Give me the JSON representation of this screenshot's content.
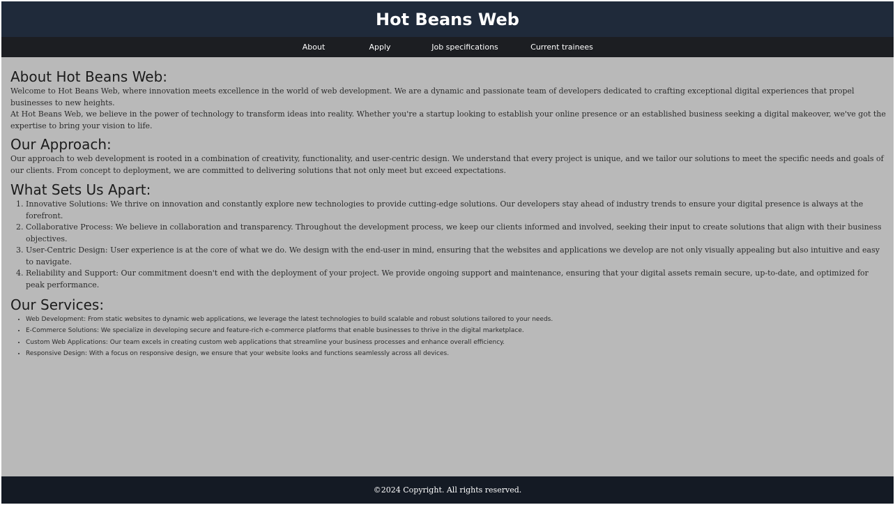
{
  "header": {
    "title": "Hot Beans Web"
  },
  "nav": {
    "items": [
      "About",
      "Apply",
      "Job specifications",
      "Current trainees"
    ]
  },
  "about": {
    "heading": "About Hot Beans Web:",
    "p1": "Welcome to Hot Beans Web, where innovation meets excellence in the world of web development. We are a dynamic and passionate team of developers dedicated to crafting exceptional digital experiences that propel businesses to new heights.",
    "p2": "At Hot Beans Web, we believe in the power of technology to transform ideas into reality. Whether you're a startup looking to establish your online presence or an established business seeking a digital makeover, we've got the expertise to bring your vision to life."
  },
  "approach": {
    "heading": "Our Approach:",
    "p1": "Our approach to web development is rooted in a combination of creativity, functionality, and user-centric design. We understand that every project is unique, and we tailor our solutions to meet the specific needs and goals of our clients. From concept to deployment, we are committed to delivering solutions that not only meet but exceed expectations."
  },
  "apart": {
    "heading": "What Sets Us Apart:",
    "items": [
      "Innovative Solutions: We thrive on innovation and constantly explore new technologies to provide cutting-edge solutions. Our developers stay ahead of industry trends to ensure your digital presence is always at the forefront.",
      "Collaborative Process: We believe in collaboration and transparency. Throughout the development process, we keep our clients informed and involved, seeking their input to create solutions that align with their business objectives.",
      "User-Centric Design: User experience is at the core of what we do. We design with the end-user in mind, ensuring that the websites and applications we develop are not only visually appealing but also intuitive and easy to navigate.",
      "Reliability and Support: Our commitment doesn't end with the deployment of your project. We provide ongoing support and maintenance, ensuring that your digital assets remain secure, up-to-date, and optimized for peak performance."
    ]
  },
  "services": {
    "heading": "Our Services:",
    "items": [
      "Web Development: From static websites to dynamic web applications, we leverage the latest technologies to build scalable and robust solutions tailored to your needs.",
      "E-Commerce Solutions: We specialize in developing secure and feature-rich e-commerce platforms that enable businesses to thrive in the digital marketplace.",
      "Custom Web Applications: Our team excels in creating custom web applications that streamline your business processes and enhance overall efficiency.",
      "Responsive Design: With a focus on responsive design, we ensure that your website looks and functions seamlessly across all devices."
    ]
  },
  "footer": {
    "text": "©2024 Copyright. All rights reserved."
  },
  "colors": {
    "header_bg": "#1f2a3a",
    "nav_bg": "#1c1e22",
    "page_bg": "#b9b9b9",
    "footer_bg": "#141a24"
  }
}
